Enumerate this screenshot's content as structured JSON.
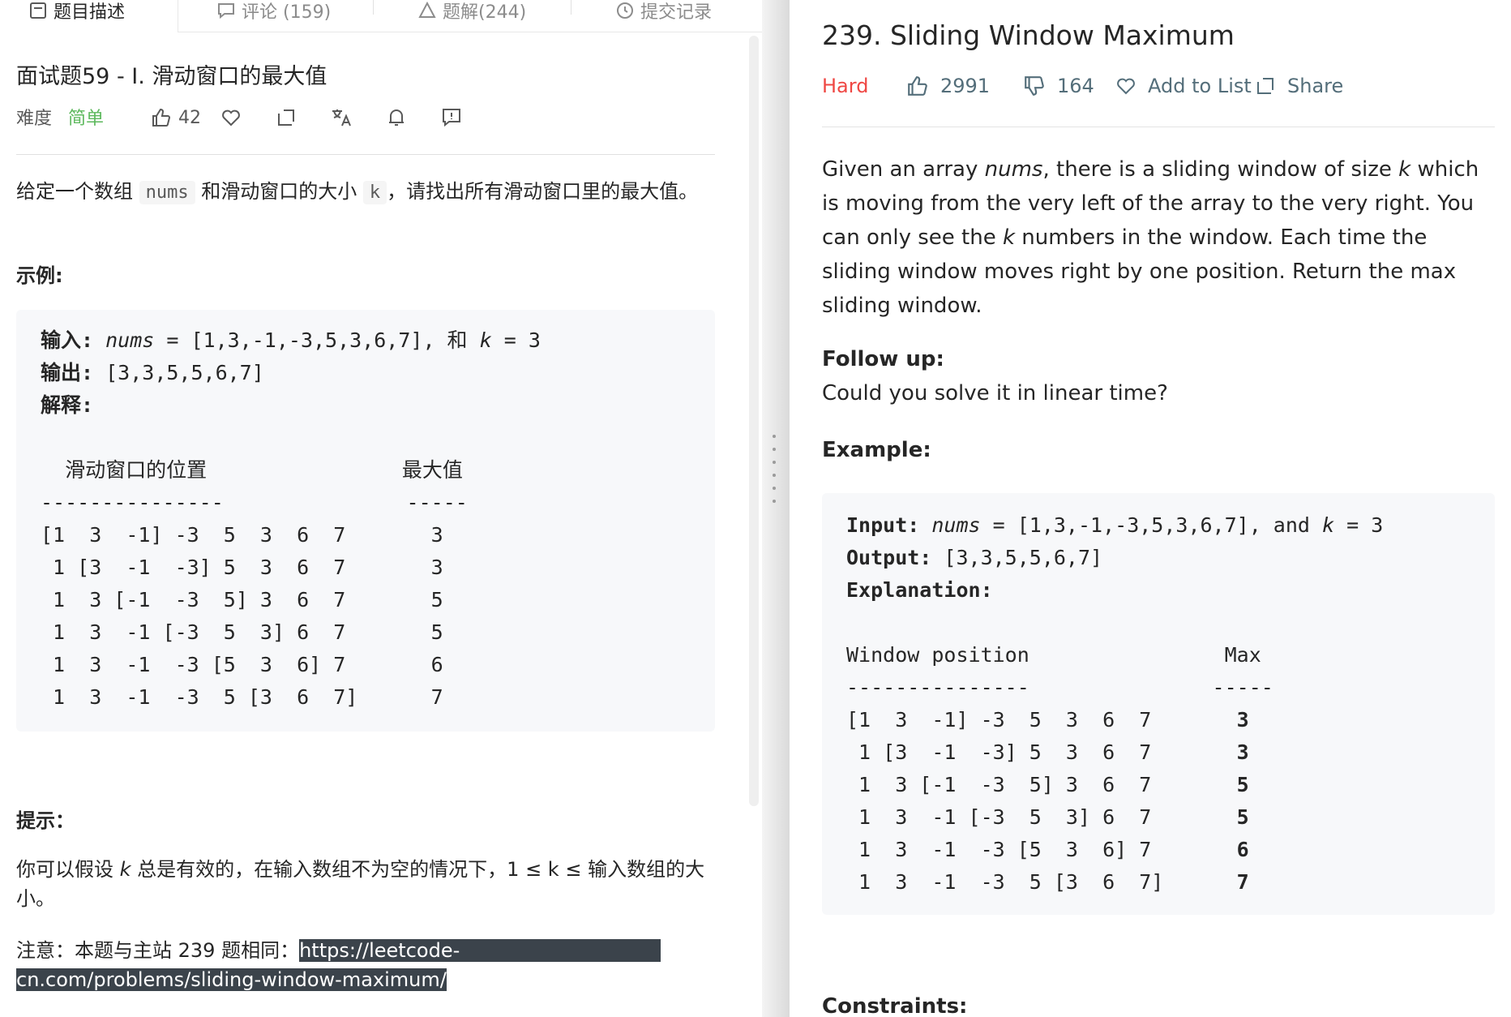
{
  "left": {
    "tabs": [
      {
        "label": "题目描述",
        "icon": "document-icon"
      },
      {
        "label": "评论 (159)",
        "icon": "comment-icon"
      },
      {
        "label": "题解(244)",
        "icon": "solution-icon"
      },
      {
        "label": "提交记录",
        "icon": "history-icon"
      }
    ],
    "title": "面试题59 - I. 滑动窗口的最大值",
    "meta": {
      "difficulty_label": "难度",
      "difficulty": "简单",
      "likes": "42",
      "difficulty_color": "#5cb85c"
    },
    "description": {
      "part1": "给定一个数组 ",
      "code1": "nums",
      "part2": " 和滑动窗口的大小 ",
      "code2": "k",
      "part3": "，请找出所有滑动窗口里的最大值。"
    },
    "example_heading": "示例:",
    "example": {
      "input_label": "输入: ",
      "input_var": "nums",
      "input_value": " = [1,3,-1,-3,5,3,6,7], 和 ",
      "input_k": "k",
      "input_k_value": " = 3",
      "output_label": "输出: ",
      "output_value": "[3,3,5,5,6,7]",
      "explanation_label": "解释: ",
      "col_window": "  滑动窗口的位置                最大值",
      "dashes": "---------------               -----",
      "rows": [
        "[1  3  -1] -3  5  3  6  7       3",
        " 1 [3  -1  -3] 5  3  6  7       3",
        " 1  3 [-1  -3  5] 3  6  7       5",
        " 1  3  -1 [-3  5  3] 6  7       5",
        " 1  3  -1  -3 [5  3  6] 7       6",
        " 1  3  -1  -3  5 [3  6  7]      7"
      ]
    },
    "hint_heading": "提示：",
    "hint": {
      "part1": "你可以假设 ",
      "k": "k",
      "part2": " 总是有效的，在输入数组不为空的情况下，1 ≤ k ≤ 输入数组的大小。"
    },
    "note": {
      "prefix": "注意：本题与主站 239 题相同：",
      "link_a": "https://leetcode-",
      "link_b": "cn.com/problems/sliding-window-maximum/"
    }
  },
  "right": {
    "title": "239. Sliding Window Maximum",
    "difficulty": "Hard",
    "likes": "2991",
    "dislikes": "164",
    "add_to_list": "Add to List",
    "share": "Share",
    "description": {
      "t1": "Given an array ",
      "nums": "nums",
      "t2": ", there is a sliding window of size ",
      "k1": "k",
      "t3": " which is moving from the very left of the array to the very right. You can only see the ",
      "k2": "k",
      "t4": " numbers in the window. Each time the sliding window moves right by one position. Return the max sliding window."
    },
    "follow_up_heading": "Follow up:",
    "follow_up": "Could you solve it in linear time?",
    "example_heading": "Example:",
    "example": {
      "input_label": "Input: ",
      "input_var": "nums",
      "input_value": " = [1,3,-1,-3,5,3,6,7], and ",
      "input_k": "k",
      "input_k_value": " = 3",
      "output_label": "Output: ",
      "output_value": "[3,3,5,5,6,7]",
      "explanation_label": "Explanation: ",
      "col_header": "Window position                Max",
      "dashes": "---------------               -----",
      "rows": [
        {
          "window": "[1  3  -1] -3  5  3  6  7       ",
          "max": "3"
        },
        {
          "window": " 1 [3  -1  -3] 5  3  6  7       ",
          "max": "3"
        },
        {
          "window": " 1  3 [-1  -3  5] 3  6  7       ",
          "max": "5"
        },
        {
          "window": " 1  3  -1 [-3  5  3] 6  7       ",
          "max": "5"
        },
        {
          "window": " 1  3  -1  -3 [5  3  6] 7       ",
          "max": "6"
        },
        {
          "window": " 1  3  -1  -3  5 [3  6  7]      ",
          "max": "7"
        }
      ]
    },
    "constraints_heading": "Constraints:"
  }
}
